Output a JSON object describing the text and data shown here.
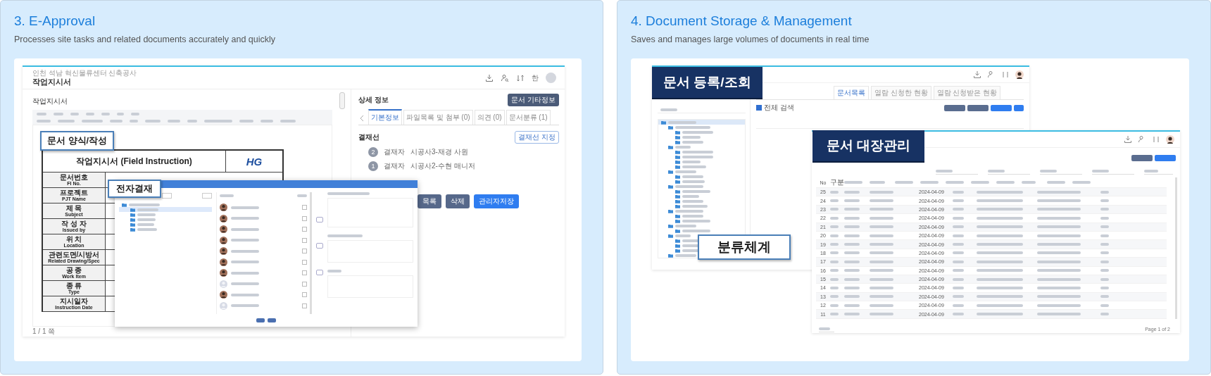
{
  "approval_card": {
    "title": "3. E-Approval",
    "subtitle": "Processes site tasks and related documents accurately and quickly",
    "window": {
      "project": "인천 석남 혁신물류센터 신축공사",
      "title": "작업지시서",
      "language": "한"
    },
    "editor": {
      "label": "작업지시서",
      "page_status": "1 / 1 쪽",
      "form_title": "작업지시서 (Field Instruction)",
      "logo": "HG",
      "rows": [
        {
          "ko": "문서번호",
          "en": "FI No."
        },
        {
          "ko": "프로젝트",
          "en": "PJT Name"
        },
        {
          "ko": "제 목",
          "en": "Subject"
        },
        {
          "ko": "작 성 자",
          "en": "Issued by"
        },
        {
          "ko": "위 치",
          "en": "Location"
        },
        {
          "ko": "관련도면/시방서",
          "en": "Related Drawing/Spec"
        },
        {
          "ko": "공 종",
          "en": "Work Item"
        },
        {
          "ko": "종 류",
          "en": "Type"
        },
        {
          "ko": "지시일자",
          "en": "Instruction Date"
        }
      ]
    },
    "detail": {
      "title": "상세 정보",
      "info_button": "문서 기타정보",
      "tabs": [
        {
          "label": "기본정보",
          "selected": true
        },
        {
          "label": "파일목록 및 첨부 (0)",
          "selected": false
        },
        {
          "label": "의견 (0)",
          "selected": false
        },
        {
          "label": "문서분류 (1)",
          "selected": false
        }
      ],
      "line_label": "결재선",
      "assign_button": "결재선 지정",
      "approvers": [
        {
          "step": "2",
          "role": "결재자",
          "name": "시공사3-재경 사원"
        },
        {
          "step": "1",
          "role": "결재자",
          "name": "시공사2-수현 매니저"
        }
      ],
      "actions": [
        {
          "label": "목록",
          "kind": "secondary"
        },
        {
          "label": "삭제",
          "kind": "secondary"
        },
        {
          "label": "관리자저장",
          "kind": "primary"
        }
      ]
    },
    "dialog": {
      "people": [
        {
          "kind": "photo",
          "checked": false
        },
        {
          "kind": "photo",
          "checked": false
        },
        {
          "kind": "photo",
          "checked": false
        },
        {
          "kind": "photo",
          "checked": false
        },
        {
          "kind": "photo",
          "checked": false
        },
        {
          "kind": "photo",
          "checked": false
        },
        {
          "kind": "photo",
          "checked": false
        },
        {
          "kind": "placeholder",
          "checked": false
        },
        {
          "kind": "photo",
          "checked": false
        },
        {
          "kind": "placeholder",
          "checked": false
        }
      ]
    },
    "callouts": [
      {
        "text": "문서 양식/작성",
        "kind": "light"
      },
      {
        "text": "전자결재",
        "kind": "light"
      }
    ]
  },
  "storage_card": {
    "title": "4.  Document Storage & Management",
    "subtitle": "Saves and manages large volumes of documents in real time",
    "register_window": {
      "tabs": [
        {
          "label": "문서목록",
          "selected": true
        },
        {
          "label": "열람 신청한 현황",
          "selected": false
        },
        {
          "label": "열람 신청받은 현황",
          "selected": false
        }
      ],
      "search_all": {
        "label": "전체 검색",
        "checked": true
      }
    },
    "ledger_window": {
      "columns": [
        "No",
        "구분"
      ],
      "page_info": "Page 1 of 2",
      "rows": [
        {
          "no": "25",
          "date": "2024-04-09"
        },
        {
          "no": "24",
          "date": "2024-04-09"
        },
        {
          "no": "23",
          "date": "2024-04-09"
        },
        {
          "no": "22",
          "date": "2024-04-09"
        },
        {
          "no": "21",
          "date": "2024-04-09"
        },
        {
          "no": "20",
          "date": "2024-04-09"
        },
        {
          "no": "19",
          "date": "2024-04-09"
        },
        {
          "no": "18",
          "date": "2024-04-09"
        },
        {
          "no": "17",
          "date": "2024-04-09"
        },
        {
          "no": "16",
          "date": "2024-04-09"
        },
        {
          "no": "15",
          "date": "2024-04-09"
        },
        {
          "no": "14",
          "date": "2024-04-09"
        },
        {
          "no": "13",
          "date": "2024-04-09"
        },
        {
          "no": "12",
          "date": "2024-04-09"
        },
        {
          "no": "11",
          "date": "2024-04-09"
        }
      ]
    },
    "callouts": [
      {
        "text": "문서 등록/조회",
        "kind": "dark"
      },
      {
        "text": "문서 대장관리",
        "kind": "dark"
      },
      {
        "text": "분류체계",
        "kind": "light"
      }
    ]
  }
}
